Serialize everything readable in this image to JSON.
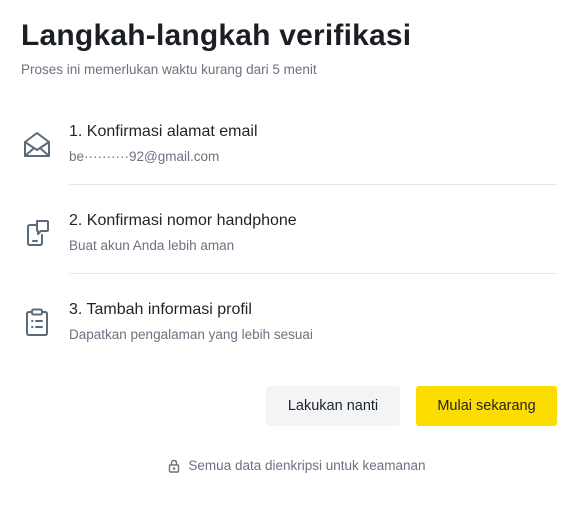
{
  "header": {
    "title": "Langkah-langkah verifikasi",
    "subtitle": "Proses ini memerlukan waktu kurang dari 5 menit"
  },
  "steps": [
    {
      "icon": "envelope-icon",
      "label": "1. Konfirmasi alamat email",
      "description": "be··········92@gmail.com"
    },
    {
      "icon": "phone-icon",
      "label": "2. Konfirmasi nomor handphone",
      "description": "Buat akun Anda lebih aman"
    },
    {
      "icon": "clipboard-icon",
      "label": "3. Tambah informasi profil",
      "description": "Dapatkan pengalaman yang lebih sesuai"
    }
  ],
  "actions": {
    "later_label": "Lakukan nanti",
    "start_label": "Mulai sekarang"
  },
  "footer": {
    "icon": "lock-icon",
    "text": "Semua data dienkripsi untuk keamanan"
  },
  "colors": {
    "primary_button": "#fddc00",
    "secondary_button": "#f3f4f6",
    "icon_stroke": "#5b6b7c",
    "muted_text": "#6b7280"
  }
}
